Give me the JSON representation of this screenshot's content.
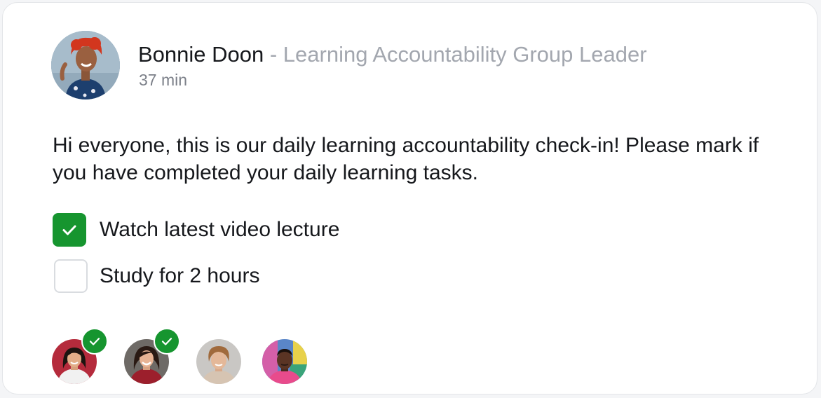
{
  "post": {
    "author_name": "Bonnie Doon",
    "author_role": " - Learning Accountability Group Leader",
    "time_ago": "37 min",
    "message": "Hi everyone, this is our daily learning accountability check-in! Please mark if you have completed your daily learning tasks."
  },
  "tasks": [
    {
      "label": "Watch latest video lecture",
      "completed": true
    },
    {
      "label": "Study for 2 hours",
      "completed": false
    }
  ],
  "participants": [
    {
      "name": "participant-1",
      "completed": true
    },
    {
      "name": "participant-2",
      "completed": true
    },
    {
      "name": "participant-3",
      "completed": false
    },
    {
      "name": "participant-4",
      "completed": false
    }
  ],
  "colors": {
    "accent_green": "#16952f",
    "muted_text": "#a3a7af",
    "text": "#16181c"
  },
  "icons": {
    "check": "check-icon"
  }
}
